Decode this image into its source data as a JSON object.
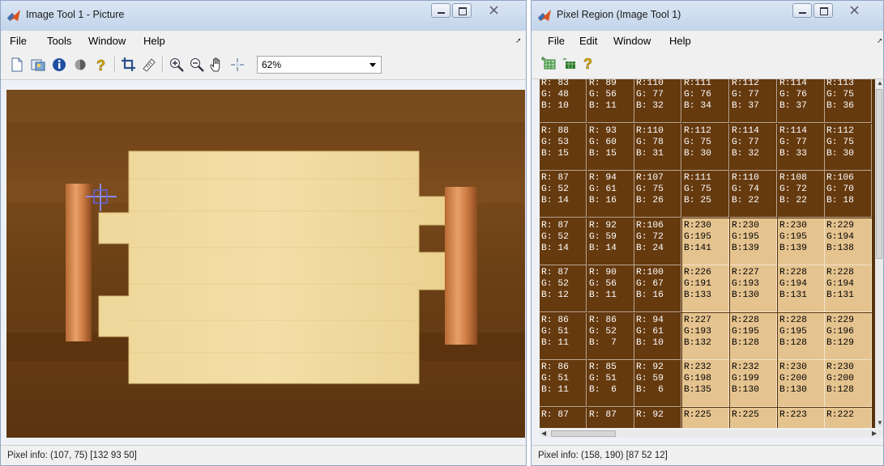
{
  "left_window": {
    "title": "Image Tool 1 - Picture",
    "menu": [
      "File",
      "Tools",
      "Window",
      "Help"
    ],
    "toolbar": {
      "icons": [
        "new-figure-icon",
        "copy-image-icon",
        "info-icon",
        "contrast-icon",
        "help-icon",
        "crop-icon",
        "measure-distance-icon",
        "zoom-in-icon",
        "zoom-out-icon",
        "pan-hand-icon",
        "pixel-region-icon"
      ],
      "zoom_value": "62%"
    },
    "status": "Pixel info: (107, 75)  [132 93 50]"
  },
  "right_window": {
    "title": "Pixel Region (Image Tool 1)",
    "menu": [
      "File",
      "Edit",
      "Window",
      "Help"
    ],
    "toolbar": {
      "icons": [
        "pixel-region-icon",
        "tile-icon",
        "help-icon"
      ]
    },
    "status": "Pixel info: (158, 190)  [87 52 12]",
    "rows": [
      [
        {
          "r": "R: 83",
          "g": "G: 48",
          "b": "B: 10",
          "dark": true
        },
        {
          "r": "R: 89",
          "g": "G: 56",
          "b": "B: 11",
          "dark": true
        },
        {
          "r": "R:110",
          "g": "G: 77",
          "b": "B: 32",
          "dark": true
        },
        {
          "r": "R:111",
          "g": "G: 76",
          "b": "B: 34",
          "dark": true
        },
        {
          "r": "R:112",
          "g": "G: 77",
          "b": "B: 37",
          "dark": true
        },
        {
          "r": "R:114",
          "g": "G: 76",
          "b": "B: 37",
          "dark": true
        },
        {
          "r": "R:113",
          "g": "G: 75",
          "b": "B: 36",
          "dark": true
        }
      ],
      [
        {
          "r": "R: 88",
          "g": "G: 53",
          "b": "B: 15",
          "dark": true
        },
        {
          "r": "R: 93",
          "g": "G: 60",
          "b": "B: 15",
          "dark": true
        },
        {
          "r": "R:110",
          "g": "G: 78",
          "b": "B: 31",
          "dark": true
        },
        {
          "r": "R:112",
          "g": "G: 75",
          "b": "B: 30",
          "dark": true
        },
        {
          "r": "R:114",
          "g": "G: 77",
          "b": "B: 32",
          "dark": true
        },
        {
          "r": "R:114",
          "g": "G: 77",
          "b": "B: 33",
          "dark": true
        },
        {
          "r": "R:112",
          "g": "G: 75",
          "b": "B: 30",
          "dark": true
        }
      ],
      [
        {
          "r": "R: 87",
          "g": "G: 52",
          "b": "B: 14",
          "dark": true
        },
        {
          "r": "R: 94",
          "g": "G: 61",
          "b": "B: 16",
          "dark": true
        },
        {
          "r": "R:107",
          "g": "G: 75",
          "b": "B: 26",
          "dark": true
        },
        {
          "r": "R:111",
          "g": "G: 75",
          "b": "B: 25",
          "dark": true
        },
        {
          "r": "R:110",
          "g": "G: 74",
          "b": "B: 22",
          "dark": true
        },
        {
          "r": "R:108",
          "g": "G: 72",
          "b": "B: 22",
          "dark": true
        },
        {
          "r": "R:106",
          "g": "G: 70",
          "b": "B: 18",
          "dark": true
        }
      ],
      [
        {
          "r": "R: 87",
          "g": "G: 52",
          "b": "B: 14",
          "dark": true
        },
        {
          "r": "R: 92",
          "g": "G: 59",
          "b": "B: 14",
          "dark": true
        },
        {
          "r": "R:106",
          "g": "G: 72",
          "b": "B: 24",
          "dark": true
        },
        {
          "r": "R:230",
          "g": "G:195",
          "b": "B:141",
          "dark": false
        },
        {
          "r": "R:230",
          "g": "G:195",
          "b": "B:139",
          "dark": false
        },
        {
          "r": "R:230",
          "g": "G:195",
          "b": "B:139",
          "dark": false
        },
        {
          "r": "R:229",
          "g": "G:194",
          "b": "B:138",
          "dark": false
        }
      ],
      [
        {
          "r": "R: 87",
          "g": "G: 52",
          "b": "B: 12",
          "dark": true
        },
        {
          "r": "R: 90",
          "g": "G: 56",
          "b": "B: 11",
          "dark": true
        },
        {
          "r": "R:100",
          "g": "G: 67",
          "b": "B: 16",
          "dark": true
        },
        {
          "r": "R:226",
          "g": "G:191",
          "b": "B:133",
          "dark": false
        },
        {
          "r": "R:227",
          "g": "G:193",
          "b": "B:130",
          "dark": false
        },
        {
          "r": "R:228",
          "g": "G:194",
          "b": "B:131",
          "dark": false
        },
        {
          "r": "R:228",
          "g": "G:194",
          "b": "B:131",
          "dark": false
        }
      ],
      [
        {
          "r": "R: 86",
          "g": "G: 51",
          "b": "B: 11",
          "dark": true
        },
        {
          "r": "R: 86",
          "g": "G: 52",
          "b": "B:  7",
          "dark": true
        },
        {
          "r": "R: 94",
          "g": "G: 61",
          "b": "B: 10",
          "dark": true
        },
        {
          "r": "R:227",
          "g": "G:193",
          "b": "B:132",
          "dark": false
        },
        {
          "r": "R:228",
          "g": "G:195",
          "b": "B:128",
          "dark": false
        },
        {
          "r": "R:228",
          "g": "G:195",
          "b": "B:128",
          "dark": false
        },
        {
          "r": "R:229",
          "g": "G:196",
          "b": "B:129",
          "dark": false
        }
      ],
      [
        {
          "r": "R: 86",
          "g": "G: 51",
          "b": "B: 11",
          "dark": true
        },
        {
          "r": "R: 85",
          "g": "G: 51",
          "b": "B:  6",
          "dark": true
        },
        {
          "r": "R: 92",
          "g": "G: 59",
          "b": "B:  6",
          "dark": true
        },
        {
          "r": "R:232",
          "g": "G:198",
          "b": "B:135",
          "dark": false
        },
        {
          "r": "R:232",
          "g": "G:199",
          "b": "B:130",
          "dark": false
        },
        {
          "r": "R:230",
          "g": "G:200",
          "b": "B:130",
          "dark": false
        },
        {
          "r": "R:230",
          "g": "G:200",
          "b": "B:128",
          "dark": false
        }
      ],
      [
        {
          "r": "R: 87",
          "dark": true
        },
        {
          "r": "R: 87",
          "dark": true
        },
        {
          "r": "R: 92",
          "dark": true
        },
        {
          "r": "R:225",
          "dark": false
        },
        {
          "r": "R:225",
          "dark": false
        },
        {
          "r": "R:223",
          "dark": false
        },
        {
          "r": "R:222",
          "dark": false
        }
      ]
    ]
  },
  "colors": {
    "dark_cell": "#663a0f",
    "light_cell": "#e5c38f",
    "title_gradient_top": "#dbe6f4",
    "title_gradient_bottom": "#c3d4ea"
  }
}
